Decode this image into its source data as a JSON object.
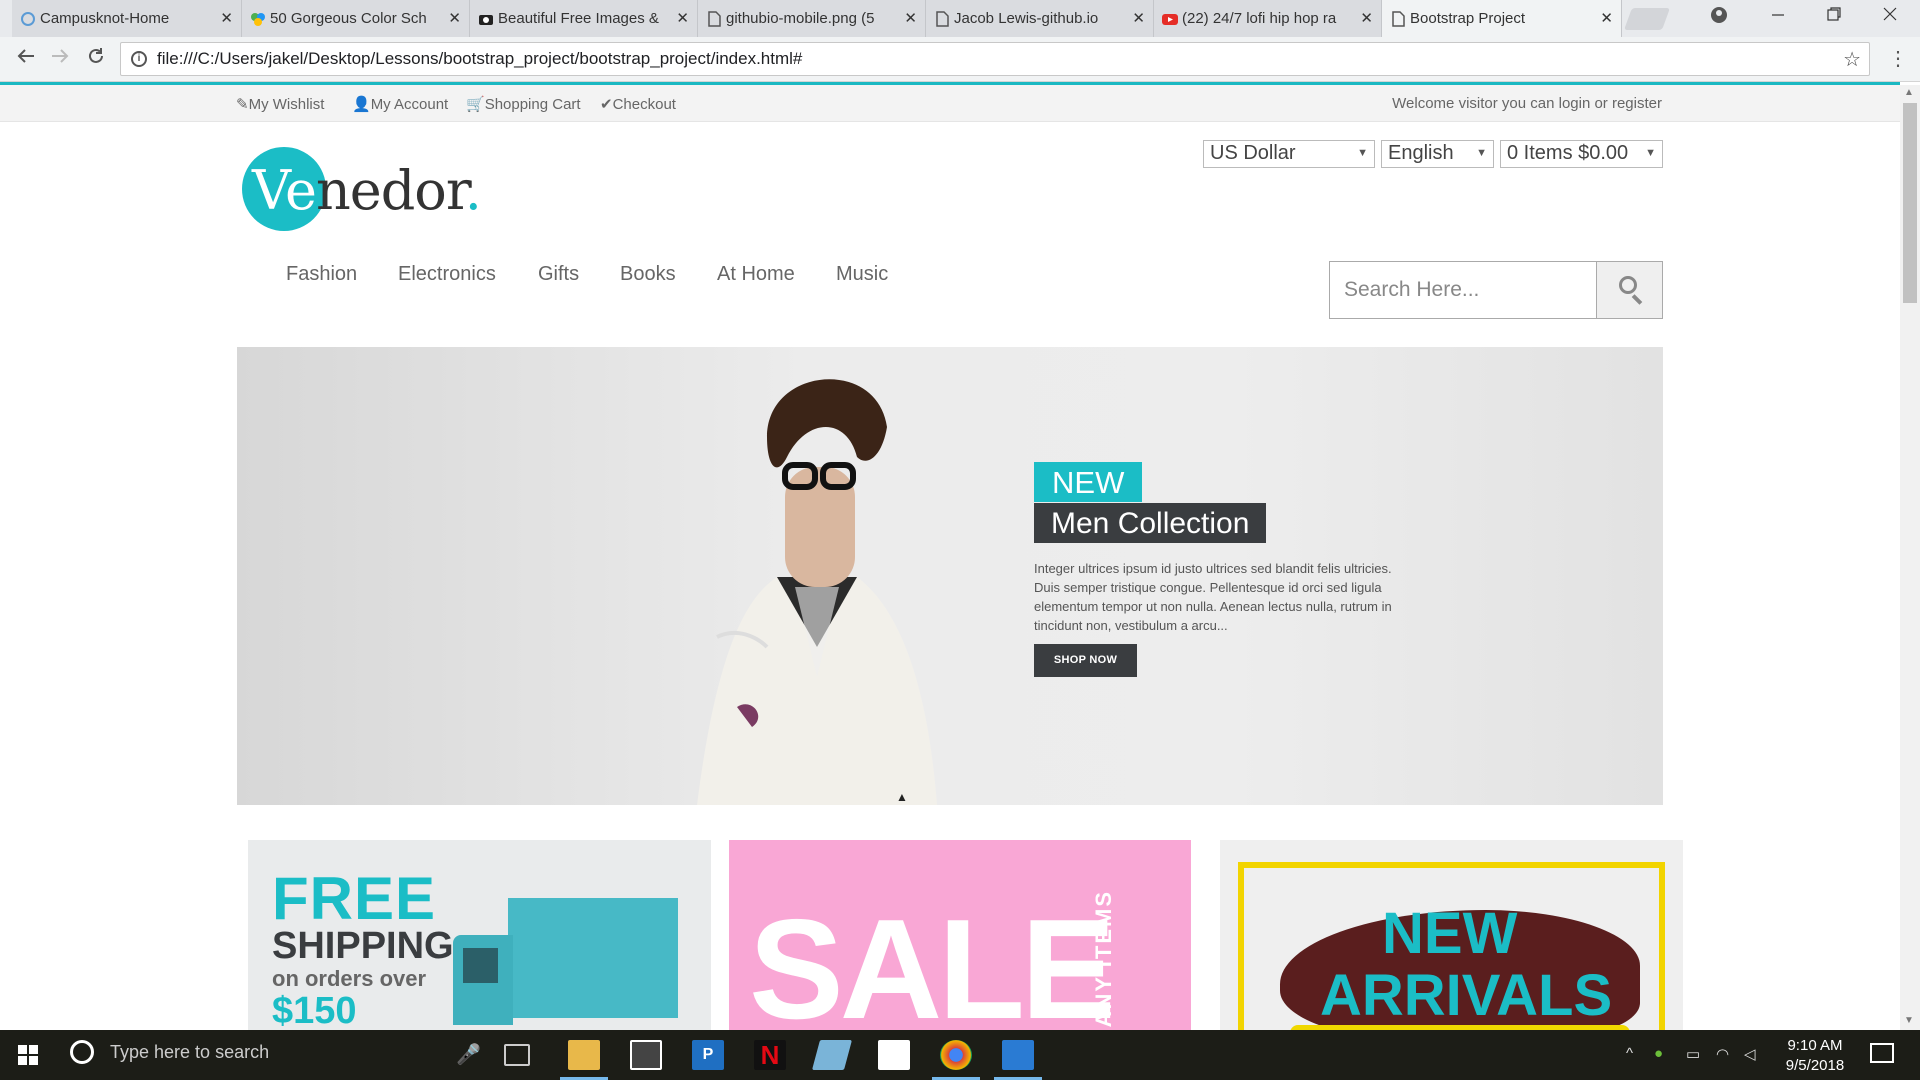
{
  "browser": {
    "tabs": [
      {
        "title": "Campusknot-Home",
        "icon": "campusknot-icon"
      },
      {
        "title": "50 Gorgeous Color Sch",
        "icon": "colors-icon"
      },
      {
        "title": "Beautiful Free Images &",
        "icon": "camera-icon"
      },
      {
        "title": "githubio-mobile.png (5",
        "icon": "file-icon"
      },
      {
        "title": "Jacob Lewis-github.io",
        "icon": "file-icon"
      },
      {
        "title": "(22) 24/7 lofi hip hop ra",
        "icon": "youtube-icon"
      },
      {
        "title": "Bootstrap Project",
        "icon": "file-icon",
        "active": true
      }
    ],
    "tab_close": "✕",
    "url": "file:///C:/Users/jakel/Desktop/Lessons/bootstrap_project/bootstrap_project/index.html#"
  },
  "site": {
    "topbar": {
      "wishlist": "My Wishlist",
      "account": "My Account",
      "cart": "Shopping Cart",
      "checkout": "Checkout",
      "welcome": "Welcome visitor you can login or register"
    },
    "logo": {
      "ve": "Ve",
      "rest": "nedor",
      "dot": "."
    },
    "selects": {
      "currency": "US Dollar",
      "language": "English",
      "cart": "0 Items $0.00"
    },
    "nav": [
      "Fashion",
      "Electronics",
      "Gifts",
      "Books",
      "At Home",
      "Music"
    ],
    "search_placeholder": "Search Here...",
    "hero": {
      "badge": "NEW",
      "collection": "Men Collection",
      "description": "Integer ultrices ipsum id justo ultrices sed blandit felis ultricies. Duis semper tristique congue. Pellentesque id orci sed ligula elementum tempor ut non nulla. Aenean lectus nulla, rutrum in tincidunt non, vestibulum a arcu...",
      "button": "SHOP NOW",
      "slide_count": 3,
      "active_slide": 1
    },
    "promos": {
      "ship": {
        "free": "FREE",
        "shipping": "SHIPPING",
        "orders": "on orders over",
        "amount": "$150"
      },
      "sale": {
        "sale": "SALE",
        "many": "MANY ITEMS"
      },
      "arrivals": {
        "new": "NEW",
        "arrivals": "ARRIVALS"
      }
    }
  },
  "taskbar": {
    "search_placeholder": "Type here to search",
    "time": "9:10 AM",
    "date": "9/5/2018"
  },
  "colors": {
    "accent": "#1bbdc6",
    "dark": "#3a3d40",
    "sale_pink": "#f9a7d5"
  }
}
